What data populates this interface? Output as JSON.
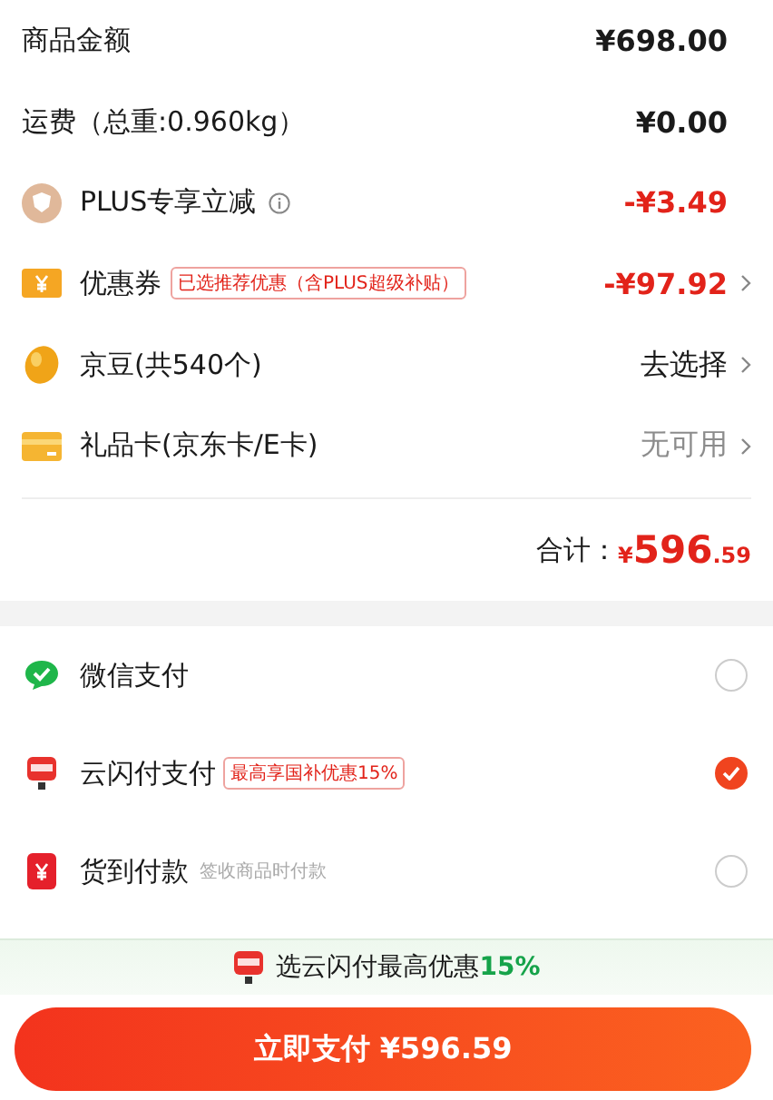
{
  "fees": [
    {
      "label": "商品金额",
      "value": "¥698.00",
      "color": "#1a1a1a",
      "chevron": false
    },
    {
      "label": "运费（总重:0.960kg）",
      "value": "¥0.00",
      "color": "#1a1a1a",
      "chevron": false
    },
    {
      "label": "PLUS专享立减",
      "info": true,
      "value": "-¥3.49",
      "color": "#e2231a",
      "chevron": false
    },
    {
      "label": "优惠券",
      "tag": "已选推荐优惠（含PLUS超级补贴）",
      "value": "-¥97.92",
      "color": "#e2231a",
      "chevron": true
    },
    {
      "label": "京豆(共540个)",
      "value": "去选择",
      "color": "#1a1a1a",
      "chevron": true
    },
    {
      "label": "礼品卡(京东卡/E卡)",
      "value": "无可用",
      "color": "#8c8c8c",
      "chevron": true
    }
  ],
  "total": {
    "label": "合计：",
    "currency": "¥",
    "integer": "596",
    "decimal": ".59"
  },
  "payments": [
    {
      "name": "微信支付",
      "selected": false
    },
    {
      "name": "云闪付支付",
      "badge": "最高享国补优惠15%",
      "selected": true
    },
    {
      "name": "货到付款",
      "hint": "签收商品时付款",
      "selected": false
    }
  ],
  "banner": {
    "text": "选云闪付最高优惠**15%**"
  },
  "pay_button": {
    "label": "立即支付 ¥596.59"
  }
}
